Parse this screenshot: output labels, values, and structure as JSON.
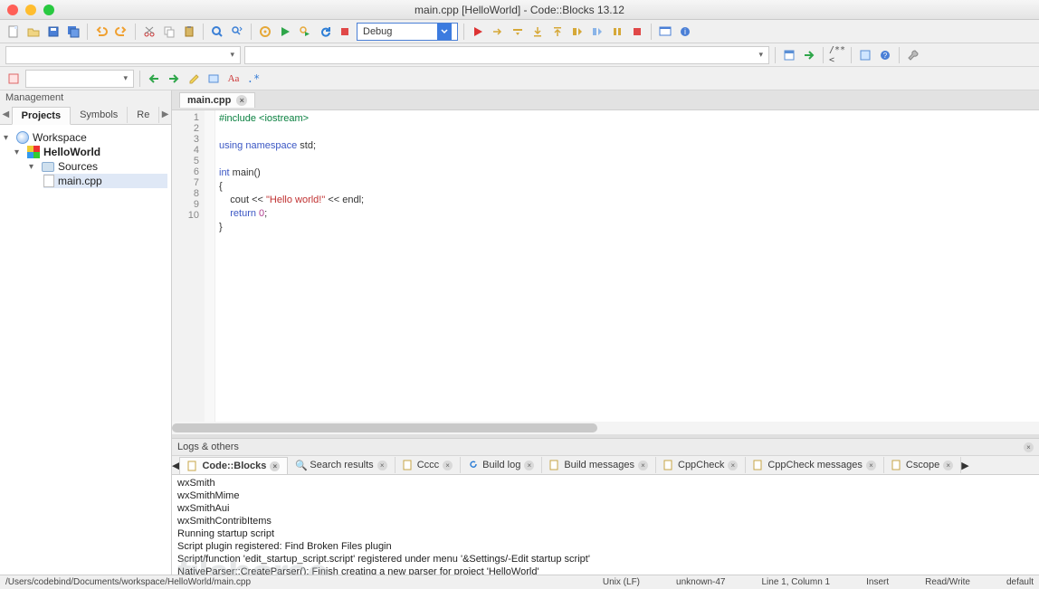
{
  "window": {
    "title": "main.cpp [HelloWorld] - Code::Blocks 13.12"
  },
  "toolbar1": {
    "build_target": "Debug"
  },
  "management": {
    "title": "Management",
    "tabs": [
      "Projects",
      "Symbols",
      "Re"
    ],
    "active_tab": 0,
    "tree": {
      "workspace": "Workspace",
      "project": "HelloWorld",
      "folder": "Sources",
      "file": "main.cpp"
    }
  },
  "editor": {
    "tab_label": "main.cpp",
    "lines": [
      {
        "n": 1,
        "html": "<span class='pp'>#include</span> <span class='t-inc'>&lt;iostream&gt;</span>"
      },
      {
        "n": 2,
        "html": ""
      },
      {
        "n": 3,
        "html": "<span class='kw'>using</span> <span class='kw'>namespace</span> std;"
      },
      {
        "n": 4,
        "html": ""
      },
      {
        "n": 5,
        "html": "<span class='kw'>int</span> main()"
      },
      {
        "n": 6,
        "html": "{"
      },
      {
        "n": 7,
        "html": "    cout &lt;&lt; <span class='str'>\"Hello world!\"</span> &lt;&lt; endl;"
      },
      {
        "n": 8,
        "html": "    <span class='kw'>return</span> <span class='num'>0</span>;"
      },
      {
        "n": 9,
        "html": "}"
      },
      {
        "n": 10,
        "html": ""
      }
    ]
  },
  "logs": {
    "header": "Logs & others",
    "tabs": [
      "Code::Blocks",
      "Search results",
      "Cccc",
      "Build log",
      "Build messages",
      "CppCheck",
      "CppCheck messages",
      "Cscope"
    ],
    "active_tab": 0,
    "lines": [
      "wxSmith",
      "wxSmithMime",
      "wxSmithAui",
      "wxSmithContribItems",
      "Running startup script",
      "Script plugin registered: Find Broken Files plugin",
      "Script/function 'edit_startup_script.script' registered under menu '&Settings/-Edit startup script'",
      "NativeParser::CreateParser(): Finish creating a new parser for project 'HelloWorld'"
    ]
  },
  "status": {
    "path": "/Users/codebind/Documents/workspace/HelloWorld/main.cpp",
    "eol": "Unix (LF)",
    "enc": "unknown-47",
    "pos": "Line 1, Column 1",
    "mode": "Insert",
    "rw": "Read/Write",
    "lang": "default"
  },
  "watermark": "filehorse"
}
